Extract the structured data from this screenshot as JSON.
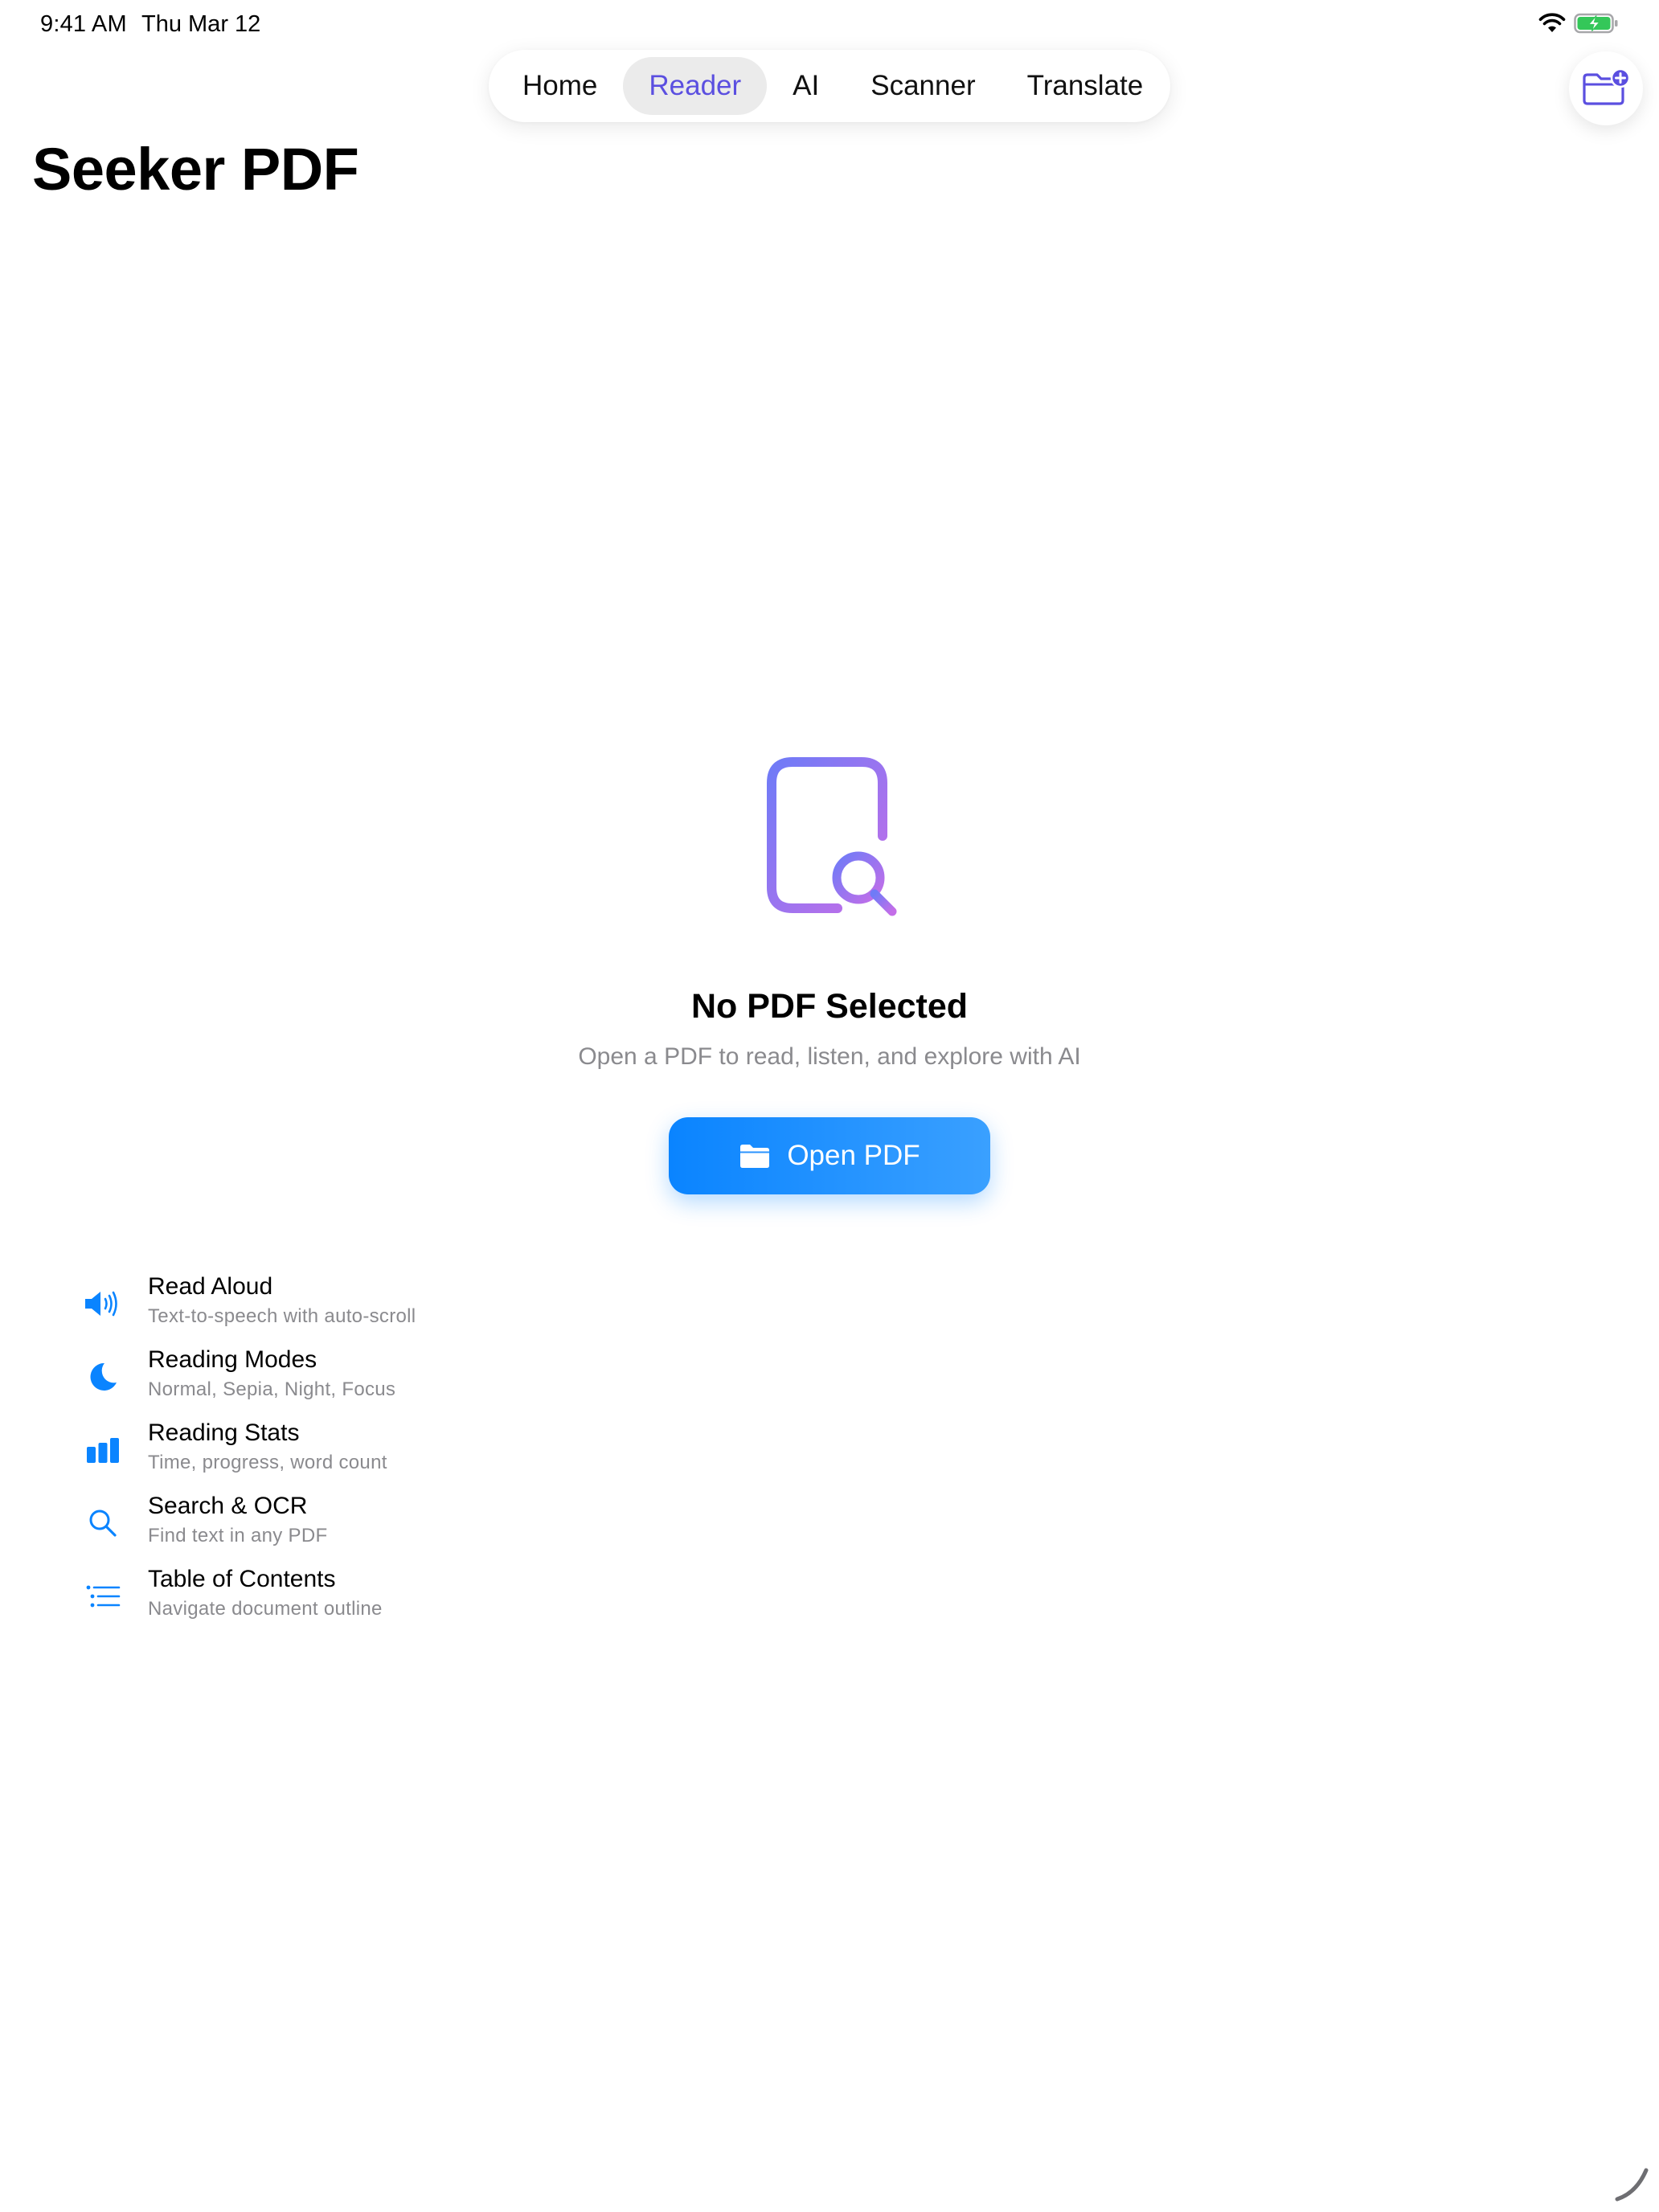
{
  "status_bar": {
    "time": "9:41 AM",
    "date": "Thu Mar 12"
  },
  "tabs": [
    {
      "label": "Home",
      "active": false
    },
    {
      "label": "Reader",
      "active": true
    },
    {
      "label": "AI",
      "active": false
    },
    {
      "label": "Scanner",
      "active": false
    },
    {
      "label": "Translate",
      "active": false
    }
  ],
  "header": {
    "title": "Seeker PDF",
    "folder_button_icon": "folder-add-icon"
  },
  "empty_state": {
    "icon": "document-search-icon",
    "title": "No PDF Selected",
    "subtitle": "Open a PDF to read, listen, and explore with AI",
    "button_label": "Open PDF",
    "button_icon": "folder-icon"
  },
  "features": [
    {
      "icon": "speaker-wave-icon",
      "title": "Read Aloud",
      "subtitle": "Text-to-speech with auto-scroll"
    },
    {
      "icon": "moon-icon",
      "title": "Reading Modes",
      "subtitle": "Normal, Sepia, Night, Focus"
    },
    {
      "icon": "bar-chart-icon",
      "title": "Reading Stats",
      "subtitle": "Time, progress, word count"
    },
    {
      "icon": "magnifier-icon",
      "title": "Search & OCR",
      "subtitle": "Find text in any PDF"
    },
    {
      "icon": "list-icon",
      "title": "Table of Contents",
      "subtitle": "Navigate document outline"
    }
  ],
  "colors": {
    "accent_blue": "#0A84FF",
    "active_tab_text": "#5B4FE0",
    "active_tab_bg": "#EBEBEB",
    "battery_green": "#34C759",
    "secondary_text": "#8A8A8E"
  }
}
